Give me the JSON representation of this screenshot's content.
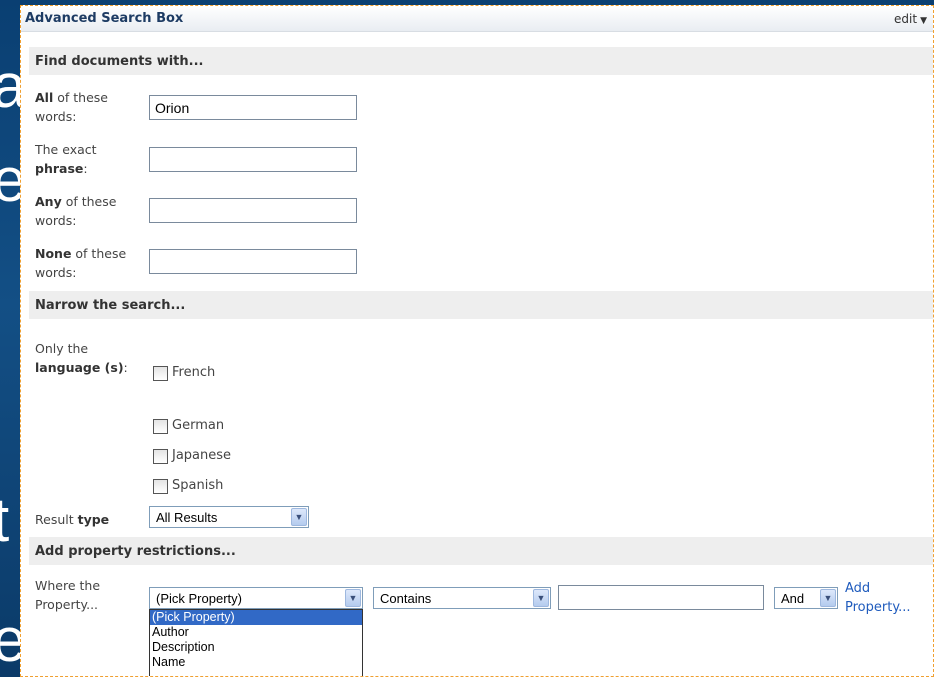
{
  "background_letters": [
    "a",
    "e",
    "t",
    "e"
  ],
  "webpart": {
    "title": "Advanced Search Box",
    "edit_label": "edit"
  },
  "find_section": {
    "heading": "Find documents with...",
    "fields": [
      {
        "label_bold": "All",
        "label_rest": " of these words:",
        "value": "Orion"
      },
      {
        "label_bold": "",
        "label_rest": "The exact ",
        "label_tail_bold": "phrase",
        "label_tail": ":",
        "value": ""
      },
      {
        "label_bold": "Any",
        "label_rest": " of these words:",
        "value": ""
      },
      {
        "label_bold": "None",
        "label_rest": " of these words:",
        "value": ""
      }
    ]
  },
  "narrow_section": {
    "heading": "Narrow the search...",
    "language_label_pre": "Only the ",
    "language_label_bold": "language (s)",
    "language_label_post": ":",
    "languages": [
      "French",
      "German",
      "Japanese",
      "Spanish"
    ],
    "result_type_label": "Result ",
    "result_type_label_bold": "type",
    "result_type_value": "All Results"
  },
  "property_section": {
    "heading": "Add property restrictions...",
    "where_label": "Where the Property...",
    "property_value": "(Pick Property)",
    "operator_value": "Contains",
    "value": "",
    "conjunction_value": "And",
    "add_property_link": "Add Property...",
    "property_options": [
      "(Pick Property)",
      "Author",
      "Description",
      "Name"
    ]
  },
  "colors": {
    "accent_link": "#1f5bbd",
    "selection": "#3169c6",
    "webpart_border": "#f0a030"
  }
}
